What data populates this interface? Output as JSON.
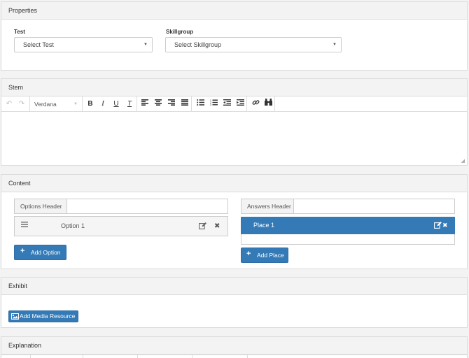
{
  "properties": {
    "title": "Properties",
    "test": {
      "label": "Test",
      "selected": "Select Test"
    },
    "skillgroup": {
      "label": "Skillgroup",
      "selected": "Select Skillgroup"
    }
  },
  "stem": {
    "title": "Stem",
    "font_family": "Verdana",
    "toolbar_icons": [
      "undo-icon",
      "redo-icon",
      "bold-icon",
      "italic-icon",
      "underline-icon",
      "clear-format-icon",
      "align-left-icon",
      "align-center-icon",
      "align-right-icon",
      "align-justify-icon",
      "bullet-list-icon",
      "numbered-list-icon",
      "outdent-icon",
      "indent-icon",
      "link-icon",
      "find-icon"
    ]
  },
  "content": {
    "title": "Content",
    "options_header_label": "Options Header",
    "answers_header_label": "Answers Header",
    "options": [
      {
        "label": "Option 1"
      }
    ],
    "places": [
      {
        "label": "Place 1"
      }
    ],
    "add_option_label": "Add Option",
    "add_place_label": "Add Place"
  },
  "exhibit": {
    "title": "Exhibit",
    "add_media_label": "Add Media Resource"
  },
  "explanation": {
    "title": "Explanation"
  },
  "colors": {
    "primary": "#337ab7",
    "panel_header": "#f3f3f3",
    "border": "#dcdcdc"
  }
}
